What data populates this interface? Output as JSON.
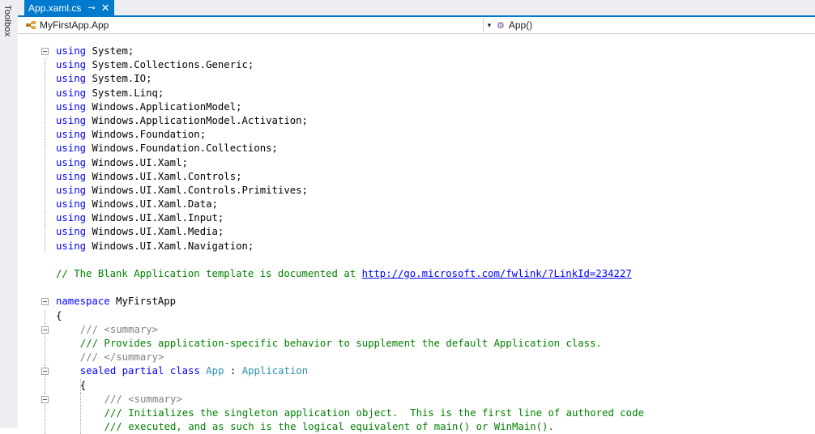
{
  "toolbox": {
    "label": "Toolbox"
  },
  "tab": {
    "title": "App.xaml.cs",
    "pin_glyph": "⊸",
    "close_glyph": "✕"
  },
  "navbar": {
    "type_name": "MyFirstApp.App",
    "member_name": "App()"
  },
  "colors": {
    "accent": "#007acc",
    "keyword": "#0000ff",
    "type": "#2b91af",
    "comment": "#008000",
    "doc_tag": "#808080"
  },
  "code": {
    "using_kw": "using",
    "usings": [
      "System;",
      "System.Collections.Generic;",
      "System.IO;",
      "System.Linq;",
      "Windows.ApplicationModel;",
      "Windows.ApplicationModel.Activation;",
      "Windows.Foundation;",
      "Windows.Foundation.Collections;",
      "Windows.UI.Xaml;",
      "Windows.UI.Xaml.Controls;",
      "Windows.UI.Xaml.Controls.Primitives;",
      "Windows.UI.Xaml.Data;",
      "Windows.UI.Xaml.Input;",
      "Windows.UI.Xaml.Media;",
      "Windows.UI.Xaml.Navigation;"
    ],
    "comment_prefix": "// The Blank Application template is documented at ",
    "comment_link": "http://go.microsoft.com/fwlink/?LinkId=234227",
    "namespace_kw": "namespace",
    "namespace_name": " MyFirstApp",
    "open_brace": "{",
    "doc_slashes": "/// ",
    "summary_open": "<summary>",
    "summary_close": "</summary>",
    "doc_line_1": "/// Provides application-specific behavior to supplement the default Application class.",
    "class_kw": "sealed partial class ",
    "class_name": "App",
    "class_sep": " : ",
    "class_base": "Application",
    "doc_line_2": "/// Initializes the singleton application object.  This is the first line of authored code",
    "doc_line_3": "/// executed, and as such is the logical equivalent of main() or WinMain()."
  }
}
